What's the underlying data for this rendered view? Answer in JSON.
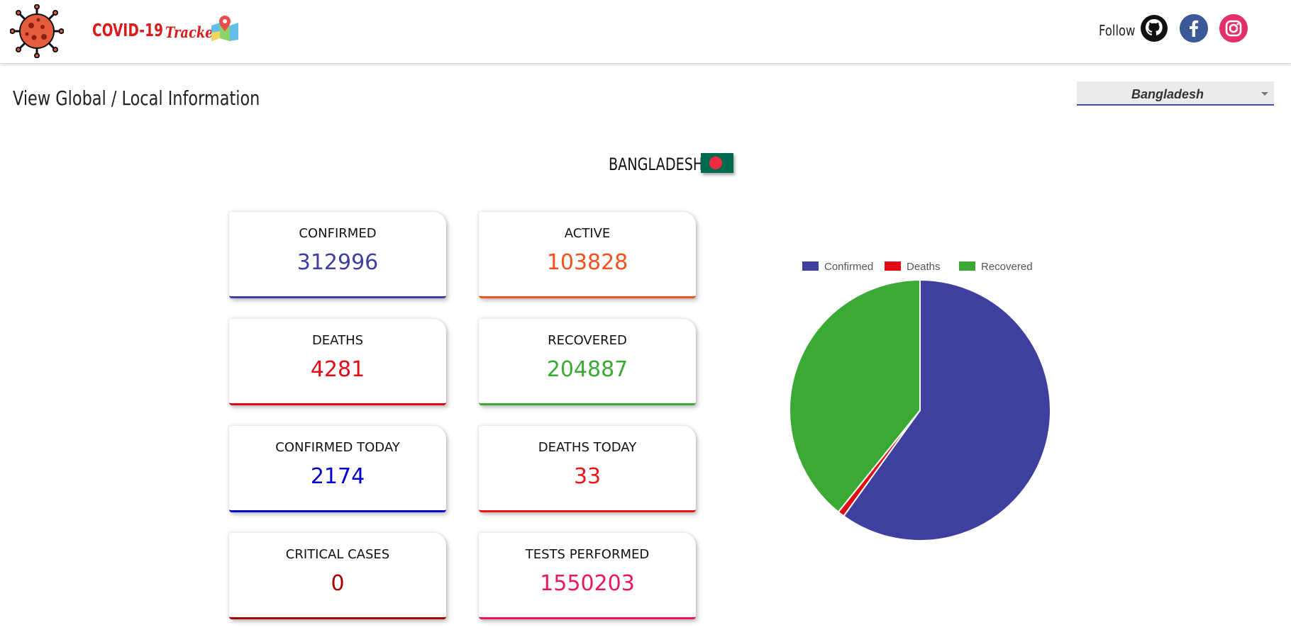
{
  "header": {
    "brand_title": "COVID-19",
    "brand_subtitle": "Tracker",
    "follow_label": "Follow",
    "logo_icon": "virus-icon",
    "map_icon": "map-pin-icon",
    "social": [
      {
        "name": "github",
        "icon": "github-icon",
        "color": "#000000"
      },
      {
        "name": "facebook",
        "icon": "facebook-icon",
        "color": "#3b5998"
      },
      {
        "name": "instagram",
        "icon": "instagram-icon",
        "color": "#e1306c"
      }
    ]
  },
  "main": {
    "title": "View Global / Local Information",
    "selected_country": "Bangladesh",
    "country_heading": "BANGLADESH",
    "accent_color": "#3f51b5"
  },
  "cards": [
    {
      "label": "CONFIRMED",
      "value": "312996",
      "color": "#3f3fa0"
    },
    {
      "label": "ACTIVE",
      "value": "103828",
      "color": "#f4511e"
    },
    {
      "label": "DEATHS",
      "value": "4281",
      "color": "#e10b16"
    },
    {
      "label": "RECOVERED",
      "value": "204887",
      "color": "#3aaa35"
    },
    {
      "label": "CONFIRMED TODAY",
      "value": "2174",
      "color": "#0000cc"
    },
    {
      "label": "DEATHS TODAY",
      "value": "33",
      "color": "#ef1418"
    },
    {
      "label": "CRITICAL CASES",
      "value": "0",
      "color": "#a80000"
    },
    {
      "label": "TESTS PERFORMED",
      "value": "1550203",
      "color": "#ea1660"
    }
  ],
  "chart_data": {
    "type": "pie",
    "title": "",
    "legend_position": "top",
    "categories": [
      "Confirmed",
      "Deaths",
      "Recovered"
    ],
    "values": [
      312996,
      4281,
      204887
    ],
    "colors": [
      "#3f3fa0",
      "#e10b16",
      "#3aaa35"
    ]
  }
}
